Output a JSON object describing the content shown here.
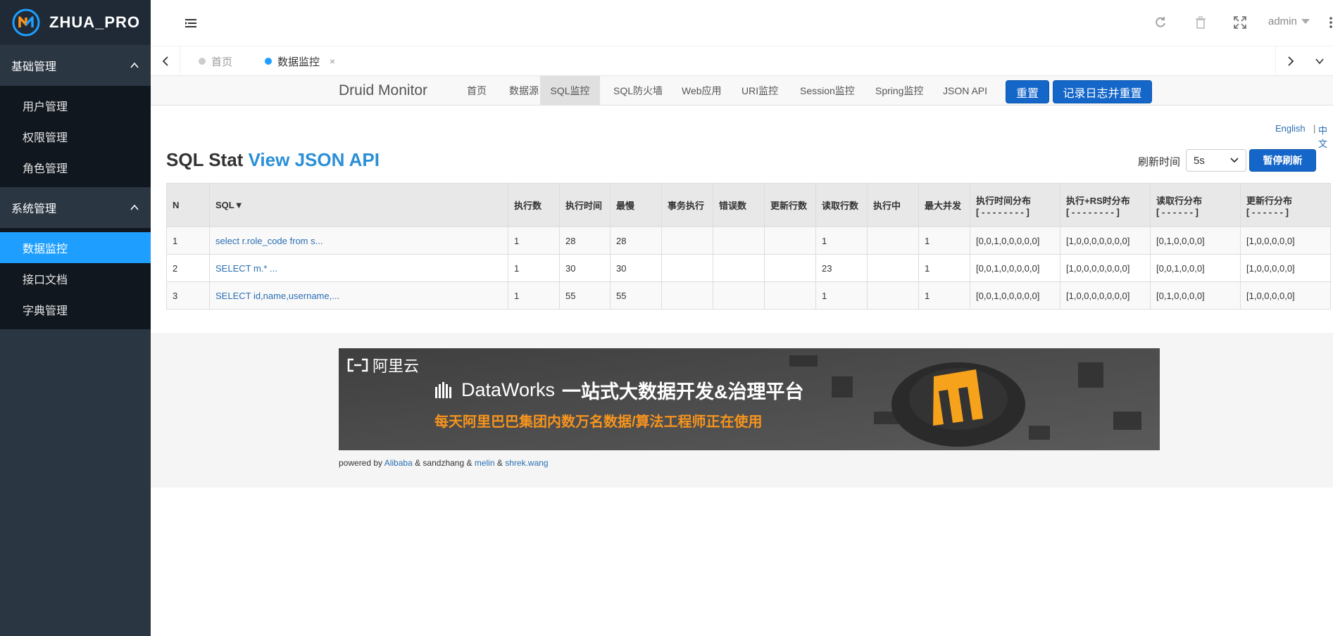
{
  "app": {
    "brand": "ZHUA_PRO"
  },
  "sidebar": {
    "groups": [
      {
        "label": "基础管理",
        "items": [
          "用户管理",
          "权限管理",
          "角色管理"
        ]
      },
      {
        "label": "系统管理",
        "items": [
          "数据监控",
          "接口文档",
          "字典管理"
        ]
      }
    ],
    "active_item": "数据监控"
  },
  "header": {
    "user": "admin",
    "icons": [
      "refresh-icon",
      "trash-icon",
      "fullscreen-icon",
      "more-vertical-icon"
    ]
  },
  "tabs": [
    {
      "label": "首页",
      "active": false
    },
    {
      "label": "数据监控",
      "active": true,
      "close": "×"
    }
  ],
  "druid": {
    "brand": "Druid Monitor",
    "nav": [
      "首页",
      "数据源",
      "SQL监控",
      "SQL防火墙",
      "Web应用",
      "URI监控",
      "Session监控",
      "Spring监控",
      "JSON API"
    ],
    "active_nav": "SQL监控",
    "reset_button": "重置",
    "log_reset_button": "记录日志并重置"
  },
  "lang": {
    "english": "English",
    "sep": "|",
    "chinese": "中文"
  },
  "page": {
    "title": "SQL Stat",
    "title_link": "View JSON API",
    "refresh_label": "刷新时间",
    "refresh_value": "5s",
    "pause_button": "暂停刷新"
  },
  "table": {
    "headers": [
      "N",
      "SQL▼",
      "执行数",
      "执行时间",
      "最慢",
      "事务执行",
      "错误数",
      "更新行数",
      "读取行数",
      "执行中",
      "最大并发",
      "执行时间分布",
      "执行+RS时分布",
      "读取行分布",
      "更新行分布"
    ],
    "header_subs": [
      "[ - - - - - - - - ]",
      "[ - - - - - - - - ]",
      "[ - - - - - - ]",
      "[ - - - - - - ]"
    ],
    "rows": [
      [
        "1",
        "select r.role_code from s...",
        "1",
        "28",
        "28",
        "",
        "",
        "",
        "1",
        "",
        "1",
        "[0,0,1,0,0,0,0,0]",
        "[1,0,0,0,0,0,0,0]",
        "[0,1,0,0,0,0]",
        "[1,0,0,0,0,0]"
      ],
      [
        "2",
        "SELECT m.* ...",
        "1",
        "30",
        "30",
        "",
        "",
        "",
        "23",
        "",
        "1",
        "[0,0,1,0,0,0,0,0]",
        "[1,0,0,0,0,0,0,0]",
        "[0,0,1,0,0,0]",
        "[1,0,0,0,0,0]"
      ],
      [
        "3",
        "SELECT id,name,username,...",
        "1",
        "55",
        "55",
        "",
        "",
        "",
        "1",
        "",
        "1",
        "[0,0,1,0,0,0,0,0]",
        "[1,0,0,0,0,0,0,0]",
        "[0,1,0,0,0,0]",
        "[1,0,0,0,0,0]"
      ]
    ]
  },
  "banner": {
    "logo": "阿里云",
    "product": "DataWorks",
    "headline": "一站式大数据开发&治理平台",
    "sub": "每天阿里巴巴集团内数万名数据/算法工程师正在使用"
  },
  "footer": {
    "prefix": "powered by",
    "alibaba": "Alibaba",
    "amp1": "& sandzhang &",
    "melin": "melin",
    "amp2": "&",
    "shrek": "shrek.wang"
  },
  "colors": {
    "sidebar": "#2b3643",
    "active": "#1e9fff",
    "button": "#1466c9",
    "link": "#2a8fd6"
  }
}
